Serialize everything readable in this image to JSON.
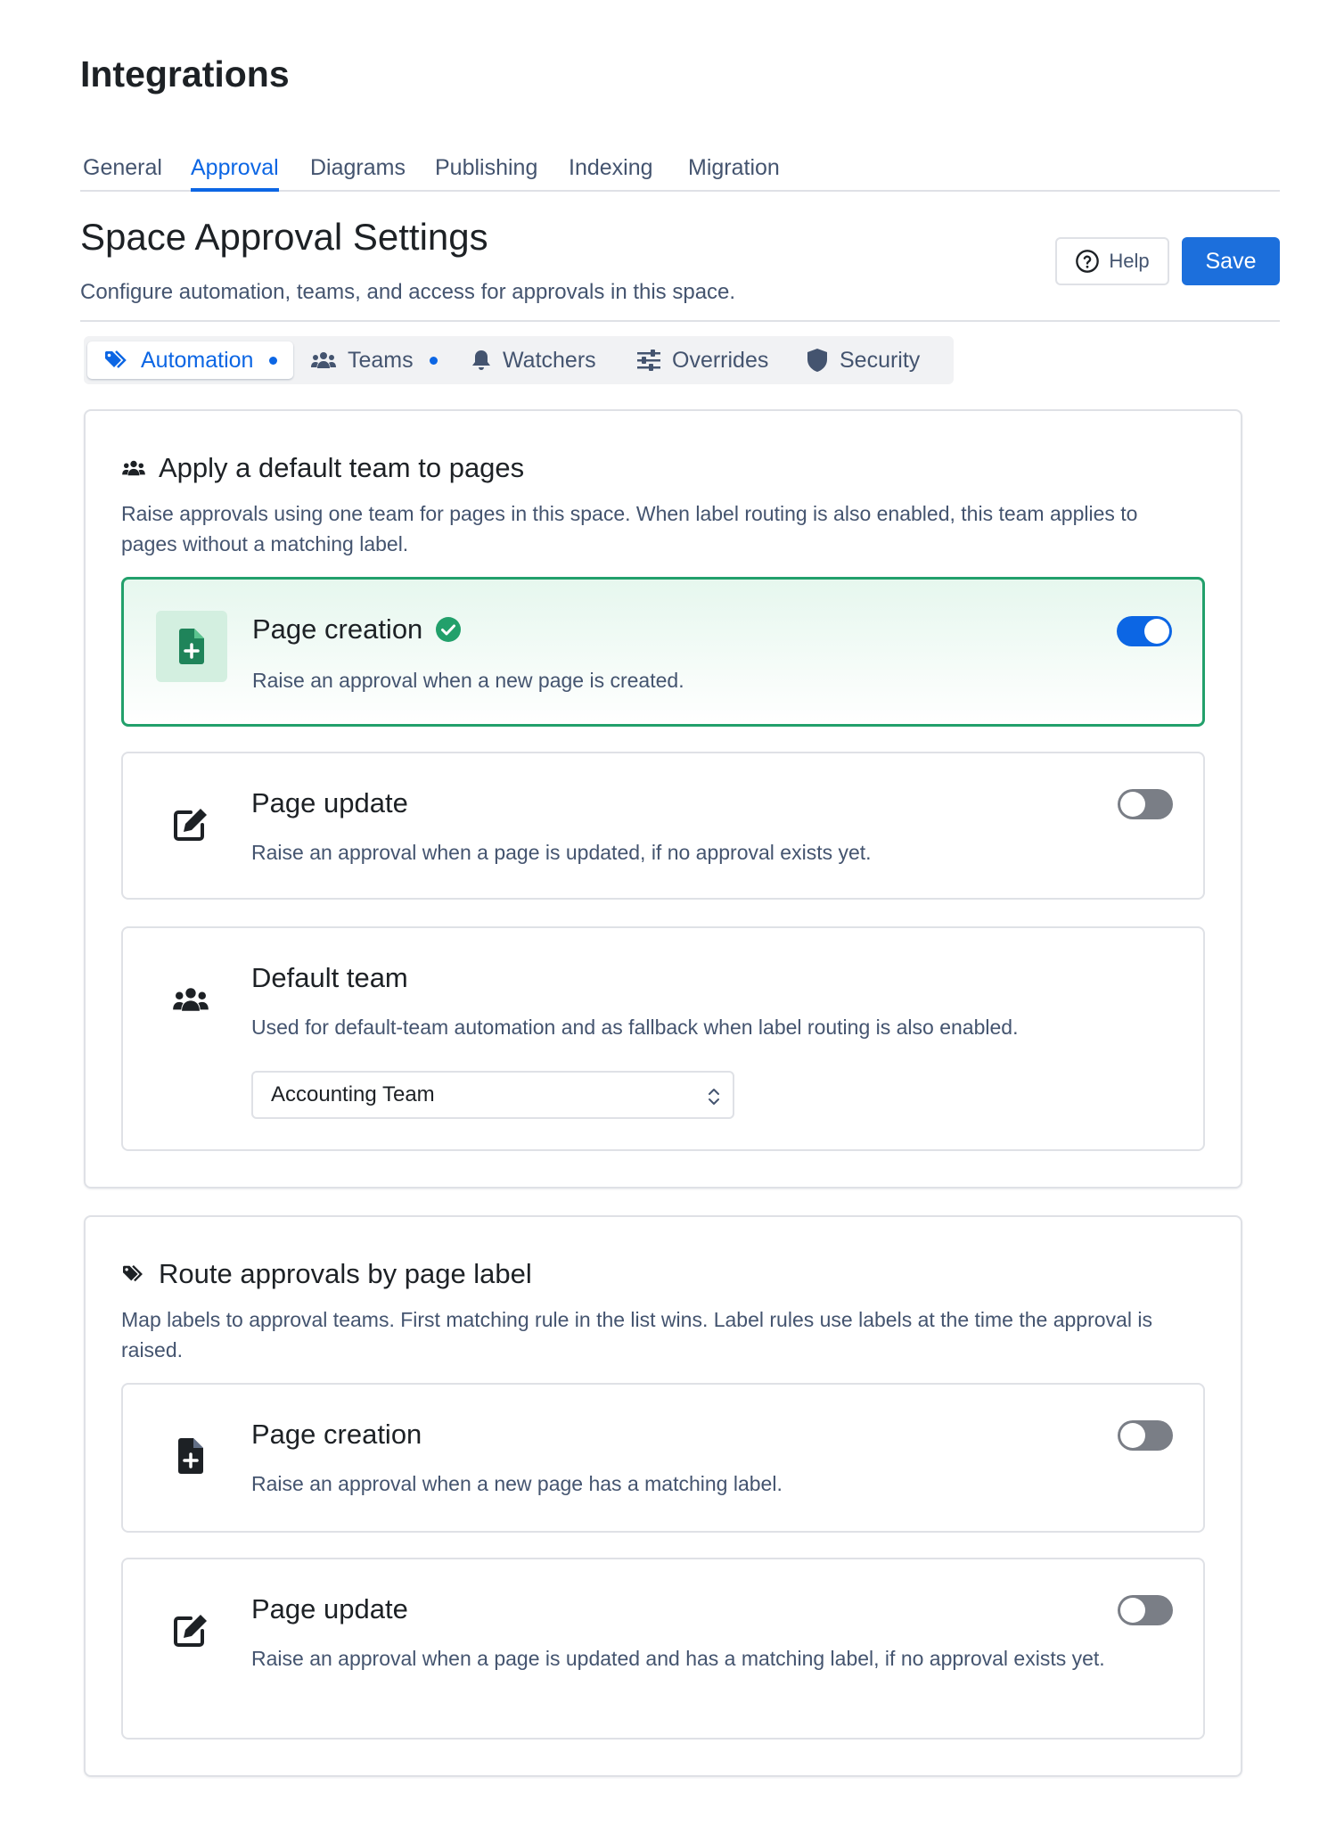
{
  "app": {
    "title": "Integrations"
  },
  "tabs": [
    "General",
    "Approval",
    "Diagrams",
    "Publishing",
    "Indexing",
    "Migration"
  ],
  "header": {
    "title": "Space Approval Settings",
    "subtitle": "Configure automation, teams, and access for approvals in this space.",
    "help_label": "Help",
    "save_label": "Save"
  },
  "subtabs": [
    {
      "label": "Automation",
      "icon": "tags-icon"
    },
    {
      "label": "Teams",
      "icon": "users-icon"
    },
    {
      "label": "Watchers",
      "icon": "bell-icon"
    },
    {
      "label": "Overrides",
      "icon": "sliders-icon"
    },
    {
      "label": "Security",
      "icon": "shield-icon"
    }
  ],
  "default_team": {
    "title": "Apply a default team to pages",
    "description": "Raise approvals using one team for pages in this space. When label routing is also enabled, this team applies to pages without a matching label.",
    "page_creation": {
      "title": "Page creation",
      "description": "Raise an approval when a new page is created.",
      "enabled": true
    },
    "page_update": {
      "title": "Page update",
      "description": "Raise an approval when a page is updated, if no approval exists yet.",
      "enabled": false
    },
    "team": {
      "title": "Default team",
      "description": "Used for default-team automation and as fallback when label routing is also enabled.",
      "selected": "Accounting Team"
    }
  },
  "label_routing": {
    "title": "Route approvals by page label",
    "description": "Map labels to approval teams. First matching rule in the list wins. Label rules use labels at the time the approval is raised.",
    "page_creation": {
      "title": "Page creation",
      "description": "Raise an approval when a new page has a matching label.",
      "enabled": false
    },
    "page_update": {
      "title": "Page update",
      "description": "Raise an approval when a page is updated and has a matching label, if no approval exists yet.",
      "enabled": false
    }
  },
  "colors": {
    "primary": "#0c66e4",
    "success": "#22a06b",
    "toggle_off": "#7a7e86"
  }
}
